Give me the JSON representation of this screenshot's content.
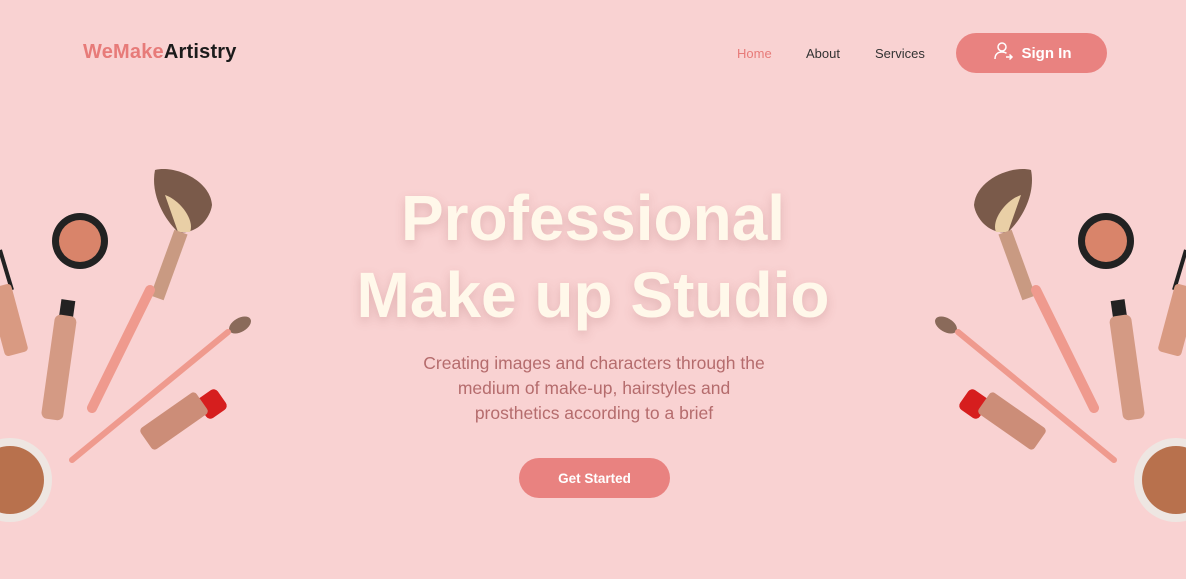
{
  "brand": {
    "part1": "WeMake",
    "part2": "Artistry"
  },
  "nav": {
    "items": [
      "Home",
      "About",
      "Services"
    ],
    "active": "Home"
  },
  "signin": {
    "label": "Sign In",
    "icon": "user-icon"
  },
  "hero": {
    "title_line1": "Professional",
    "title_line2": "Make up Studio",
    "subtitle_line1": "Creating images and characters through the",
    "subtitle_line2": "medium of make-up, hairstyles and",
    "subtitle_line3": "prosthetics according to a brief",
    "cta": "Get Started"
  },
  "colors": {
    "background": "#f9d2d2",
    "accent": "#e98280",
    "title": "#fff8ea",
    "subtitle": "#b56c6d"
  }
}
